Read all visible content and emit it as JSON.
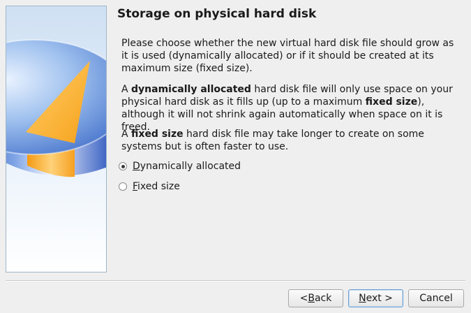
{
  "wizard": {
    "title": "Storage on physical hard disk",
    "intro": "Please choose whether the new virtual hard disk file should grow as it is used (dynamically allocated) or if it should be created at its maximum size (fixed size).",
    "dynamic_desc": {
      "prefix": "A ",
      "bold1": "dynamically allocated",
      "mid": " hard disk file will only use space on your physical hard disk as it fills up (up to a maximum ",
      "bold2": "fixed size",
      "suffix": "), although it will not shrink again automatically when space on it is freed."
    },
    "fixed_desc": {
      "prefix": "A ",
      "bold": "fixed size",
      "suffix": " hard disk file may take longer to create on some systems but is often faster to use."
    },
    "options": [
      {
        "mnemonic": "D",
        "rest": "ynamically allocated",
        "checked": true
      },
      {
        "mnemonic": "F",
        "rest": "ixed size",
        "checked": false
      }
    ]
  },
  "buttons": {
    "back": {
      "prefix": "< ",
      "mnemonic": "B",
      "rest": "ack"
    },
    "next": {
      "mnemonic": "N",
      "rest": "ext >"
    },
    "cancel": "Cancel"
  },
  "icons": {
    "side_image": "hard-disk-illustration-icon"
  },
  "colors": {
    "disk_blue": "#3f6fd0",
    "disk_orange": "#f7a21b",
    "accent_border": "#6f9fcf"
  }
}
